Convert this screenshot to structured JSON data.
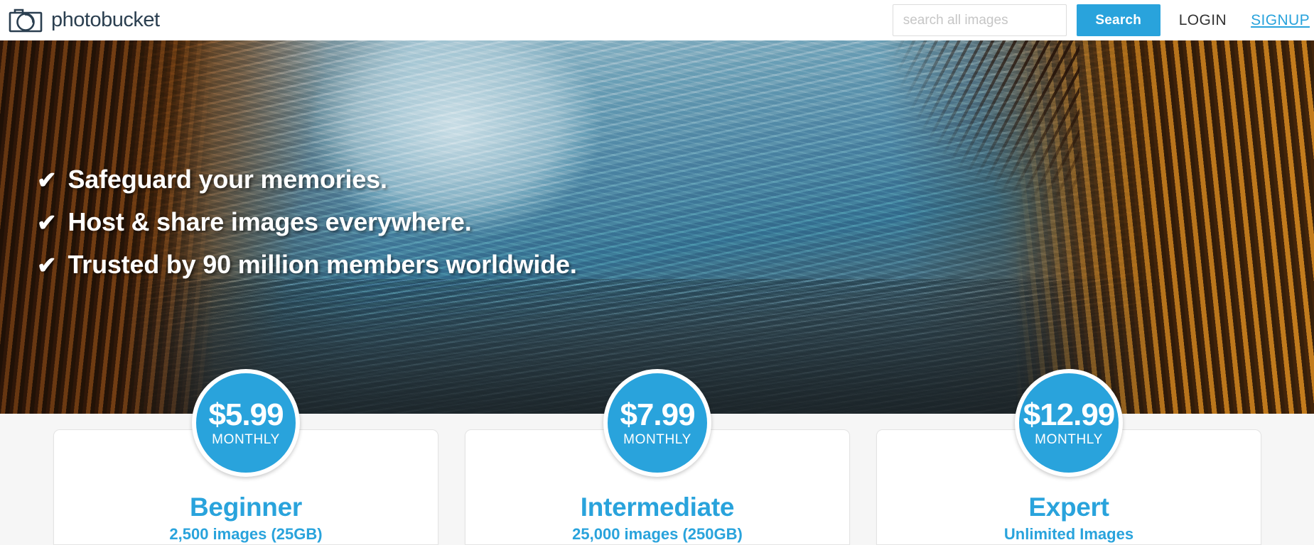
{
  "header": {
    "logo_icon": "camera-icon",
    "brand_name": "photobucket",
    "search": {
      "placeholder": "search all images",
      "value": "",
      "button_label": "Search"
    },
    "login_label": "LOGIN",
    "signup_label": "SIGNUP"
  },
  "hero": {
    "claims": [
      {
        "check": "✔",
        "text": "Safeguard your memories."
      },
      {
        "check": "✔",
        "text": "Host & share images everywhere."
      },
      {
        "check": "✔",
        "text": "Trusted by 90 million members worldwide."
      }
    ],
    "image_description": "snow-covered mountain valley framed by autumn conifers"
  },
  "pricing": {
    "plans": [
      {
        "price": "$5.99",
        "period": "MONTHLY",
        "title": "Beginner",
        "subtitle": "2,500 images (25GB)"
      },
      {
        "price": "$7.99",
        "period": "MONTHLY",
        "title": "Intermediate",
        "subtitle": "25,000 images (250GB)"
      },
      {
        "price": "$12.99",
        "period": "MONTHLY",
        "title": "Expert",
        "subtitle": "Unlimited Images"
      }
    ]
  },
  "colors": {
    "accent_blue": "#29a3dc",
    "logo_navy": "#2b3f50",
    "page_background": "#f6f6f6",
    "card_background": "#ffffff",
    "text_dark": "#333333"
  }
}
